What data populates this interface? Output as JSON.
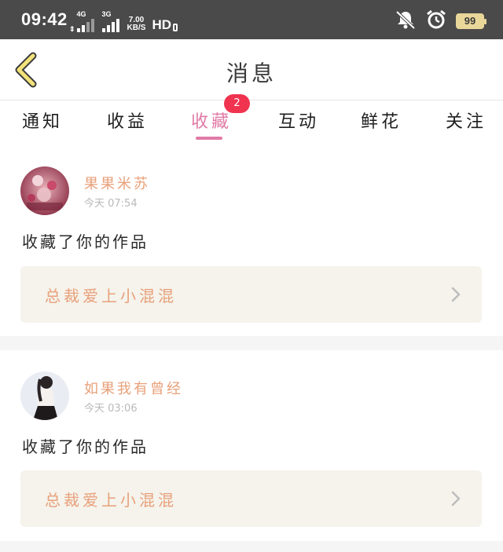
{
  "status_bar": {
    "time": "09:42",
    "net_type_1": "4G",
    "net_type_2": "3G",
    "speed_value": "7.00",
    "speed_unit": "KB/S",
    "hd_label": "HD",
    "battery": "99",
    "icons": [
      "mute-icon",
      "alarm-icon",
      "battery-icon"
    ]
  },
  "header": {
    "title": "消息",
    "back_icon": "chevron-left-icon"
  },
  "tabs": [
    {
      "label": "通知",
      "active": false
    },
    {
      "label": "收益",
      "active": false
    },
    {
      "label": "收藏",
      "active": true,
      "badge": "2"
    },
    {
      "label": "互动",
      "active": false
    },
    {
      "label": "鲜花",
      "active": false
    },
    {
      "label": "关注",
      "active": false
    }
  ],
  "colors": {
    "accent_pink": "#e07aa6",
    "badge_red": "#f0334f",
    "name_orange": "#e8a07a",
    "link_bg": "#f5f3ec"
  },
  "messages": [
    {
      "user_name": "果果米苏",
      "time": "今天 07:54",
      "text": "收藏了你的作品",
      "work_title": "总裁爱上小混混"
    },
    {
      "user_name": "如果我有曾经",
      "time": "今天 03:06",
      "text": "收藏了你的作品",
      "work_title": "总裁爱上小混混"
    }
  ]
}
